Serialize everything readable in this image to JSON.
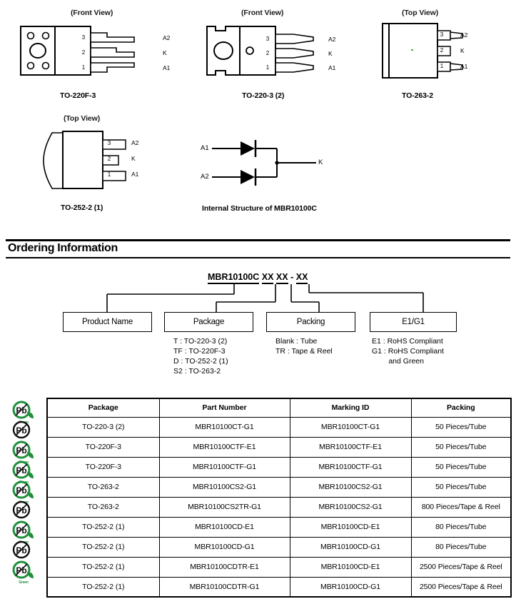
{
  "packages": [
    {
      "id": "to-220f-3",
      "view": "(Front View)",
      "name": "TO-220F-3",
      "pins": [
        {
          "num": "3",
          "label": "A2"
        },
        {
          "num": "2",
          "label": "K"
        },
        {
          "num": "1",
          "label": "A1"
        }
      ]
    },
    {
      "id": "to-220-3-2",
      "view": "(Front View)",
      "name": "TO-220-3 (2)",
      "pins": [
        {
          "num": "3",
          "label": "A2"
        },
        {
          "num": "2",
          "label": "K"
        },
        {
          "num": "1",
          "label": "A1"
        }
      ]
    },
    {
      "id": "to-263-2",
      "view": "(Top View)",
      "name": "TO-263-2",
      "pins": [
        {
          "num": "3",
          "label": "A2"
        },
        {
          "num": "2",
          "label": "K"
        },
        {
          "num": "1",
          "label": "A1"
        }
      ]
    },
    {
      "id": "to-252-2-1",
      "view": "(Top View)",
      "name": "TO-252-2 (1)",
      "pins": [
        {
          "num": "3",
          "label": "A2"
        },
        {
          "num": "2",
          "label": "K"
        },
        {
          "num": "1",
          "label": "A1"
        }
      ]
    }
  ],
  "internal_structure": {
    "caption": "Internal Structure of MBR10100C",
    "anode1": "A1",
    "anode2": "A2",
    "cathode": "K"
  },
  "section": {
    "title": "Ordering Information"
  },
  "ordering_code": {
    "product": "MBR10100C",
    "package_code": "XX",
    "packing_code": "XX",
    "dash": "-",
    "grade_code": "XX"
  },
  "ordering_boxes": [
    {
      "label": "Product Name",
      "notes": ""
    },
    {
      "label": "Package",
      "notes": "T : TO-220-3 (2)\nTF : TO-220F-3\nD : TO-252-2 (1)\nS2 : TO-263-2"
    },
    {
      "label": "Packing",
      "notes": "Blank : Tube\nTR : Tape & Reel"
    },
    {
      "label": "E1/G1",
      "notes": "E1 : RoHS Compliant\nG1 : RoHS Compliant\n        and Green"
    }
  ],
  "table": {
    "headers": [
      "Package",
      "Part Number",
      "Marking ID",
      "Packing"
    ],
    "rows": [
      {
        "package": "TO-220-3 (2)",
        "part": "MBR10100CT-G1",
        "marking": "MBR10100CT-G1",
        "packing": "50 Pieces/Tube",
        "badge": "green"
      },
      {
        "package": "TO-220F-3",
        "part": "MBR10100CTF-E1",
        "marking": "MBR10100CTF-E1",
        "packing": "50 Pieces/Tube",
        "badge": "black"
      },
      {
        "package": "TO-220F-3",
        "part": "MBR10100CTF-G1",
        "marking": "MBR10100CTF-G1",
        "packing": "50 Pieces/Tube",
        "badge": "green"
      },
      {
        "package": "TO-263-2",
        "part": "MBR10100CS2-G1",
        "marking": "MBR10100CS2-G1",
        "packing": "50 Pieces/Tube",
        "badge": "green"
      },
      {
        "package": "TO-263-2",
        "part": "MBR10100CS2TR-G1",
        "marking": "MBR10100CS2-G1",
        "packing": "800 Pieces/Tape & Reel",
        "badge": "green"
      },
      {
        "package": "TO-252-2 (1)",
        "part": "MBR10100CD-E1",
        "marking": "MBR10100CD-E1",
        "packing": "80 Pieces/Tube",
        "badge": "black"
      },
      {
        "package": "TO-252-2 (1)",
        "part": "MBR10100CD-G1",
        "marking": "MBR10100CD-G1",
        "packing": "80 Pieces/Tube",
        "badge": "green"
      },
      {
        "package": "TO-252-2  (1)",
        "part": "MBR10100CDTR-E1",
        "marking": "MBR10100CD-E1",
        "packing": "2500 Pieces/Tape & Reel",
        "badge": "black"
      },
      {
        "package": "TO-252-2  (1)",
        "part": "MBR10100CDTR-G1",
        "marking": "MBR10100CD-G1",
        "packing": "2500 Pieces/Tape & Reel",
        "badge": "green"
      }
    ]
  },
  "badge": {
    "pb_text": "Pb",
    "green_text": "Green",
    "green_color": "#1f8f3a",
    "black_color": "#000000"
  }
}
